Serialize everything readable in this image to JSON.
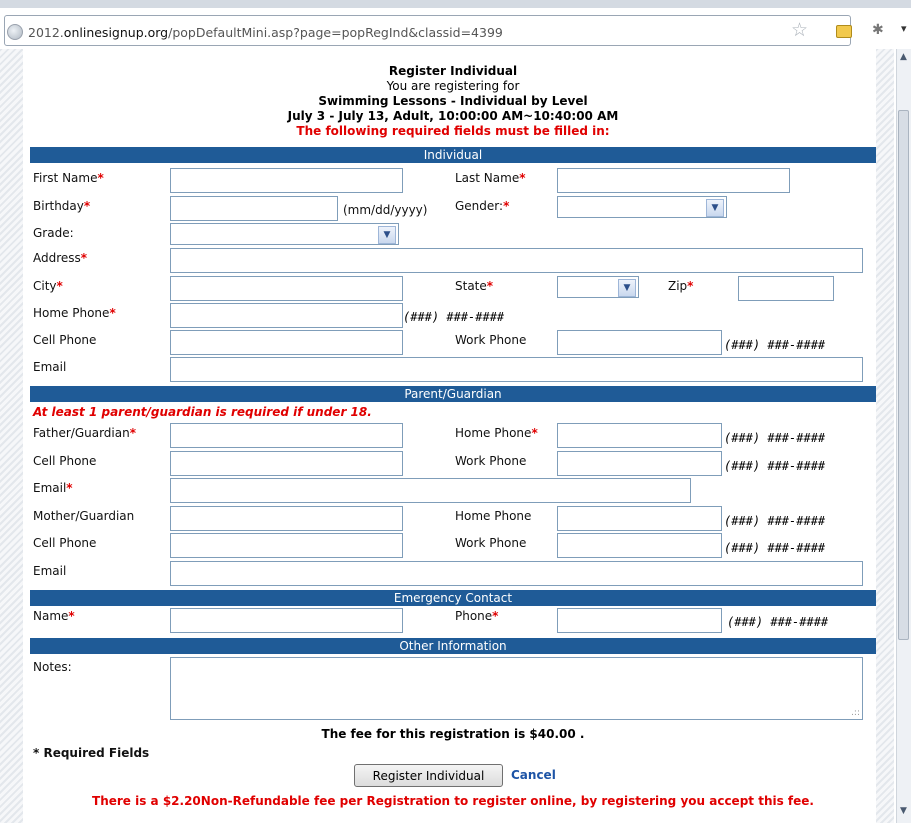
{
  "browser": {
    "url_prefix": "2012.",
    "url_domain": "onlinesignup.org",
    "url_path": "/popDefaultMini.asp?page=popRegInd&classid=4399"
  },
  "header": {
    "title": "Register Individual",
    "registering_for": "You are registering for",
    "class_name": "Swimming Lessons - Individual by Level",
    "schedule": "July 3 - July 13, Adult, 10:00:00 AM~10:40:00 AM",
    "required_notice": "The following required fields must be filled in:"
  },
  "sections": {
    "individual": "Individual",
    "parent": "Parent/Guardian",
    "emergency": "Emergency Contact",
    "other": "Other Information"
  },
  "asterisk": "*",
  "individual": {
    "first_name": "First Name",
    "last_name": "Last Name",
    "birthday": "Birthday",
    "date_format": "(mm/dd/yyyy)",
    "gender": "Gender:",
    "grade": "Grade:",
    "address": "Address",
    "city": "City",
    "state": "State",
    "zip": "Zip",
    "home_phone": "Home Phone",
    "cell_phone": "Cell Phone",
    "work_phone": "Work Phone",
    "email": "Email"
  },
  "phone_format": "(###) ###-####",
  "parent": {
    "warning": "At least 1 parent/guardian is required if under 18.",
    "father": "Father/Guardian",
    "home_phone": "Home Phone",
    "cell_phone": "Cell Phone",
    "work_phone": "Work Phone",
    "email": "Email",
    "mother": "Mother/Guardian"
  },
  "emergency": {
    "name": "Name",
    "phone": "Phone"
  },
  "other": {
    "notes": "Notes:"
  },
  "footer": {
    "fee_text": "The fee for this registration is $40.00 .",
    "required_fields": "* Required Fields",
    "register_button": "Register Individual",
    "cancel": "Cancel",
    "online_fee_notice": "There is a $2.20Non-Refundable fee per Registration to register online, by registering you accept this fee."
  },
  "icons": {
    "site": "globe-icon",
    "bookmark": "star-icon",
    "mail": "mail-icon",
    "extension": "extension-icon",
    "dropdown": "chevron-down-icon"
  }
}
